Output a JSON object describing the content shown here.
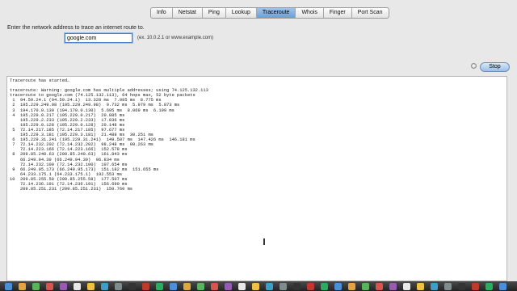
{
  "tabs": [
    "Info",
    "Netstat",
    "Ping",
    "Lookup",
    "Traceroute",
    "Whois",
    "Finger",
    "Port Scan"
  ],
  "active_tab": "Traceroute",
  "prompt": "Enter the network address to trace an internet route to.",
  "address": {
    "value": "google.com",
    "hint": "(ex. 10.0.2.1 or www.example.com)"
  },
  "stop_label": "Stop",
  "output_lines": [
    "Traceroute has started…",
    "",
    "traceroute: Warning: google.com has multiple addresses; using 74.125.132.113",
    "traceroute to google.com (74.125.132.113), 64 hops max, 52 byte packets",
    " 1  94.59.24.1 (94.59.24.1)  13.328 ms  7.085 ms  8.775 ms",
    " 2  195.229.249.98 (195.229.249.98)  9.732 ms  5.979 ms  5.873 ms",
    " 3  194.170.0.130 (194.170.0.130)  5.695 ms  8.069 ms  6.199 ms",
    " 4  195.229.0.217 (195.229.0.217)  20.885 ms",
    "    195.229.2.233 (195.229.2.233)  17.036 ms",
    "    195.229.0.128 (195.229.0.128)  20.148 ms",
    " 5  72.14.217.185 (72.14.217.185)  97.677 ms",
    "    195.229.3.181 (195.229.3.181)  21.488 ms  30.251 ms",
    " 6  195.229.31.241 (195.229.31.241)  149.507 ms  147.426 ms  146.181 ms",
    " 7  72.14.232.202 (72.14.232.202)  98.248 ms  98.263 ms",
    "    72.14.223.166 (72.14.223.166)  152.578 ms",
    " 8  209.85.240.63 (209.85.240.63)  161.843 ms",
    "    66.249.94.39 (66.249.94.39)  96.834 ms",
    "    72.14.232.100 (72.14.232.100)  107.654 ms",
    " 9  66.249.95.173 (66.249.95.173)  151.182 ms  151.655 ms",
    "    64.233.175.1 (64.233.175.1)  192.553 ms",
    "10  209.85.255.58 (209.85.255.58)  177.507 ms",
    "    72.14.236.191 (72.14.236.191)  156.690 ms",
    "    209.85.251.231 (209.85.251.231)  150.760 ms"
  ],
  "colors": {
    "accent": "#7aa8dc",
    "window_bg": "#e8e8e8",
    "panel_bg": "#ffffff",
    "dock": "#2c2c2c"
  },
  "dock_icons": [
    "finder-icon",
    "browser-icon",
    "mail-icon",
    "photos-icon",
    "music-icon",
    "calendar-icon",
    "notes-icon",
    "store-icon",
    "settings-icon",
    "terminal-icon",
    "preview-icon",
    "messages-icon",
    "maps-icon",
    "video-icon",
    "books-icon",
    "chat-icon",
    "pages-icon",
    "numbers-icon",
    "keynote-icon",
    "game-icon",
    "game-icon",
    "game-icon",
    "game-icon",
    "game-icon",
    "game-icon",
    "game-icon",
    "game-icon",
    "game-icon",
    "game-icon",
    "game-icon",
    "game-icon",
    "game-icon",
    "game-icon",
    "game-icon",
    "game-icon",
    "game-icon",
    "trash-icon"
  ]
}
